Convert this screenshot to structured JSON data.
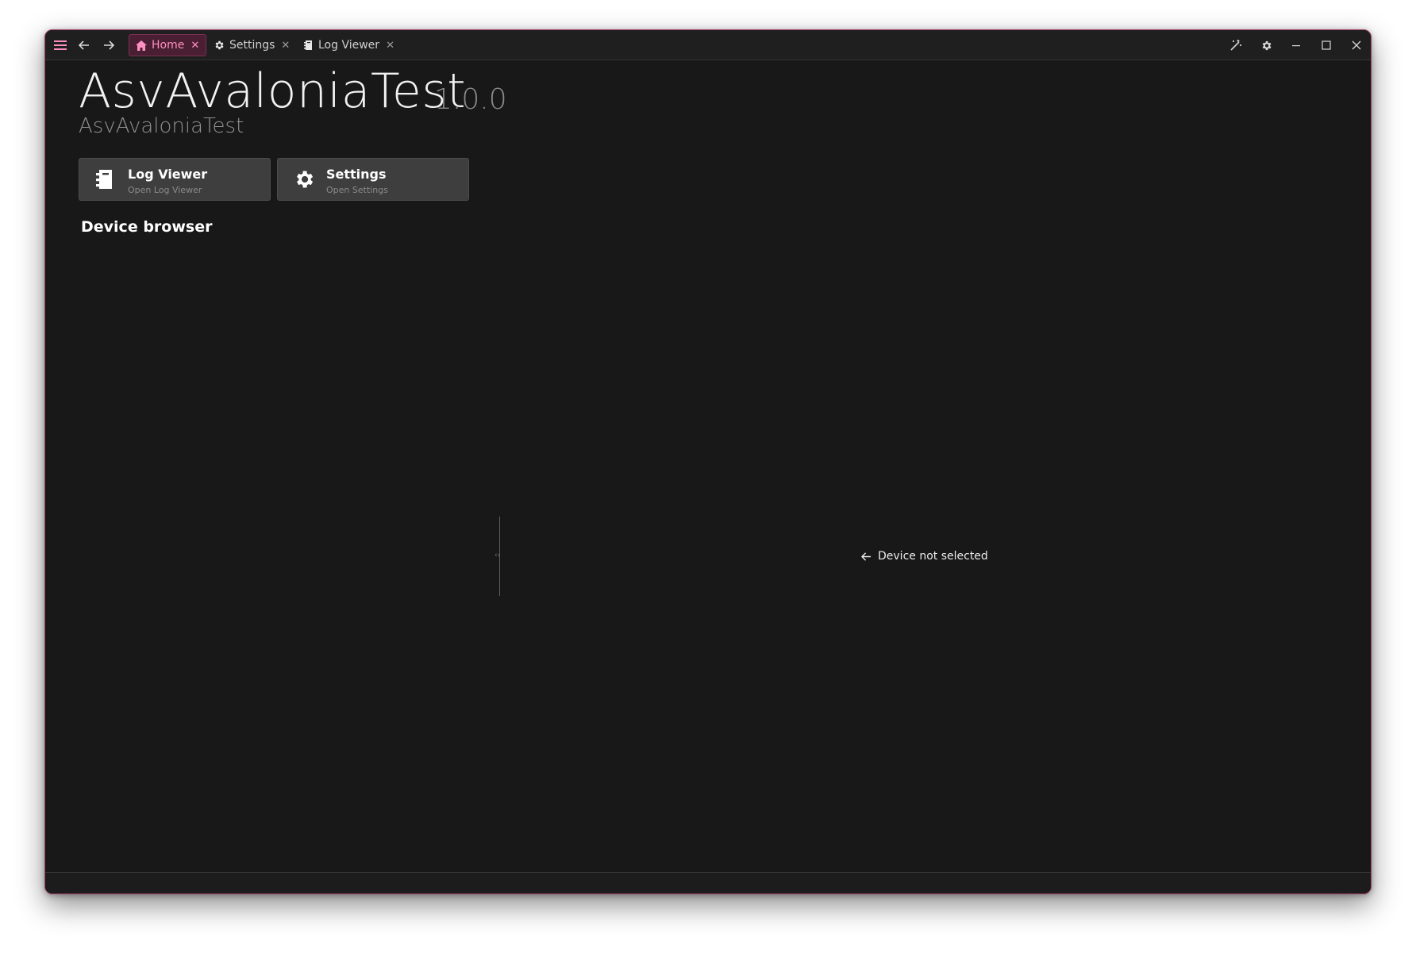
{
  "titlebar": {
    "tabs": [
      {
        "label": "Home",
        "icon": "home-icon",
        "active": true
      },
      {
        "label": "Settings",
        "icon": "gear-icon",
        "active": false
      },
      {
        "label": "Log Viewer",
        "icon": "log-file-icon",
        "active": false
      }
    ],
    "close_glyph": "✕"
  },
  "app": {
    "title": "AsvAvaloniaTest",
    "version": "1.0.0",
    "subtitle": "AsvAvaloniaTest"
  },
  "actions": [
    {
      "title": "Log Viewer",
      "subtitle": "Open Log Viewer",
      "icon": "log-file-icon"
    },
    {
      "title": "Settings",
      "subtitle": "Open Settings",
      "icon": "gear-icon"
    }
  ],
  "device_browser": {
    "title": "Device browser",
    "empty_message": "Device not selected",
    "splitter_glyph": "‹›"
  },
  "colors": {
    "accent": "#ff8fc0",
    "accent_bg": "#4a1f33",
    "window_border": "#a03c66",
    "background": "#181818",
    "card": "#3e3e3e"
  }
}
